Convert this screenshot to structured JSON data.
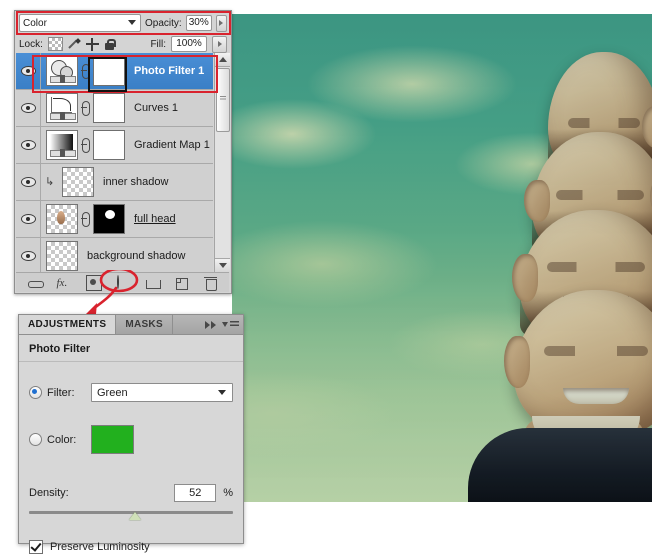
{
  "layers_panel": {
    "blend_mode": "Color",
    "opacity_label": "Opacity:",
    "opacity_value": "30%",
    "lock_label": "Lock:",
    "fill_label": "Fill:",
    "fill_value": "100%",
    "lock_icons": [
      "lock-transparency-icon",
      "lock-image-icon",
      "lock-position-icon",
      "lock-all-icon"
    ],
    "layers": [
      {
        "name": "Photo Filter 1",
        "selected": true,
        "thumb": "photo-filter-thumbnail",
        "mask": "white-mask",
        "linked": true,
        "clipped": false,
        "underlined": false
      },
      {
        "name": "Curves 1",
        "selected": false,
        "thumb": "curves-thumbnail",
        "mask": "white-mask",
        "linked": true,
        "clipped": false,
        "underlined": false
      },
      {
        "name": "Gradient Map 1",
        "selected": false,
        "thumb": "gradient-map-thumbnail",
        "mask": "white-mask",
        "linked": true,
        "clipped": false,
        "underlined": false
      },
      {
        "name": "inner shadow",
        "selected": false,
        "thumb": "transparent-thumbnail",
        "mask": "none",
        "linked": false,
        "clipped": true,
        "underlined": false
      },
      {
        "name": "full head",
        "selected": false,
        "thumb": "head-thumbnail",
        "mask": "black-mask",
        "linked": true,
        "clipped": false,
        "underlined": true
      },
      {
        "name": "background shadow",
        "selected": false,
        "thumb": "transparent-thumbnail",
        "mask": "none",
        "linked": false,
        "clipped": false,
        "underlined": false
      }
    ],
    "bottom_icons": [
      "link-layers-icon",
      "layer-style-fx-icon",
      "add-layer-mask-icon",
      "new-adjustment-layer-icon",
      "new-group-icon",
      "new-layer-icon",
      "delete-layer-icon"
    ],
    "selected_row_color": "#3a7fc6",
    "highlight_color": "#d9232e"
  },
  "adjustments_panel": {
    "tabs": [
      {
        "label": "ADJUSTMENTS",
        "active": true
      },
      {
        "label": "MASKS",
        "active": false
      }
    ],
    "collapse_icon": "double-chevron-right-icon",
    "menu_icon": "panel-menu-icon",
    "title": "Photo Filter",
    "filter_radio_label": "Filter:",
    "filter_selected": "Green",
    "color_radio_label": "Color:",
    "color_swatch": "#22b01e",
    "density_label": "Density:",
    "density_value": "52",
    "density_unit": "%",
    "density_percent": 52,
    "preserve_luminosity_label": "Preserve Luminosity",
    "preserve_luminosity_checked": true
  },
  "annotations": {
    "arrow": "red-curved-arrow",
    "circle": "red-circle-highlight"
  },
  "photo": {
    "description": "surreal-layered-head-photo"
  }
}
